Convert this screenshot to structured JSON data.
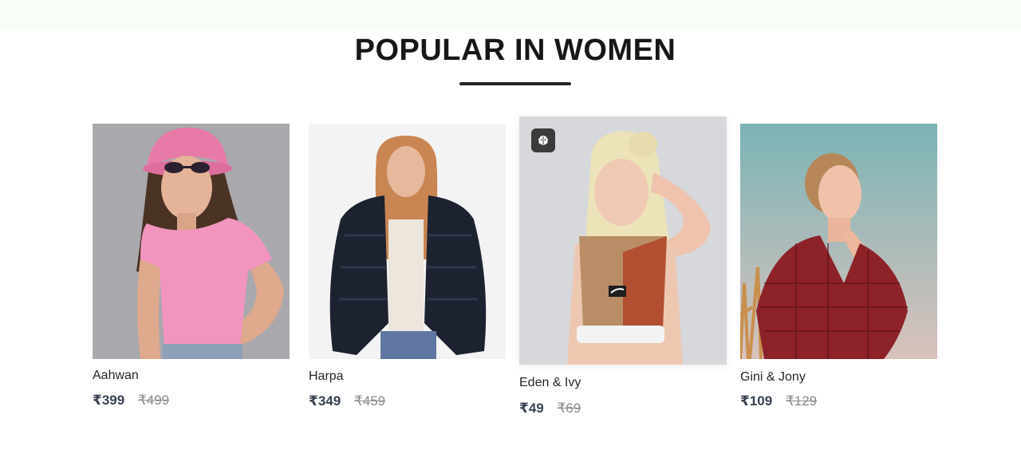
{
  "section": {
    "title": "POPULAR IN WOMEN"
  },
  "products": [
    {
      "name": "Aahwan",
      "price": "₹399",
      "old_price": "₹499"
    },
    {
      "name": "Harpa",
      "price": "₹349",
      "old_price": "₹459"
    },
    {
      "name": "Eden & Ivy",
      "price": "₹49",
      "old_price": "₹69"
    },
    {
      "name": "Gini & Jony",
      "price": "₹109",
      "old_price": "₹129"
    }
  ],
  "colors": {
    "top_band": "#f8fff9",
    "title": "#171717",
    "price_new": "#374151",
    "price_old": "#8a8a8a"
  },
  "icons": {
    "badge": "brain-icon"
  }
}
